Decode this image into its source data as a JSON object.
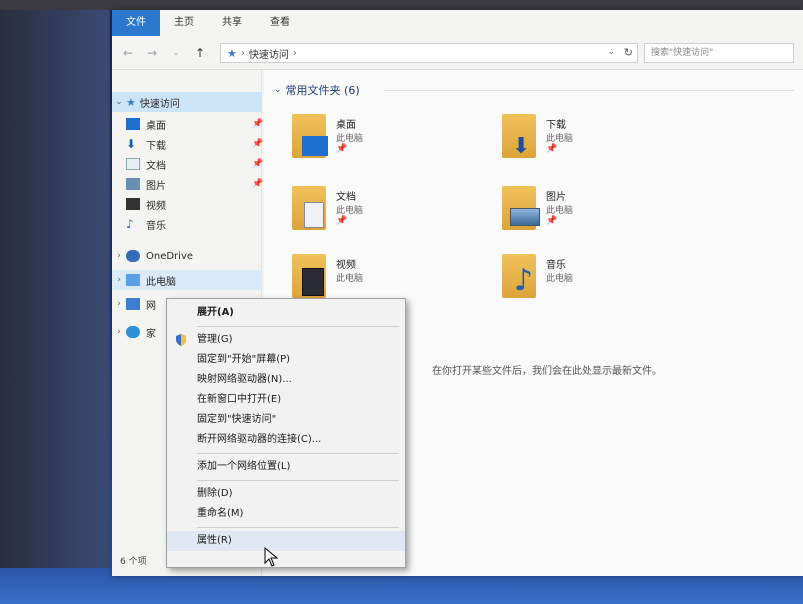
{
  "ribbon": {
    "tabs": [
      "文件",
      "主页",
      "共享",
      "查看"
    ]
  },
  "address": {
    "path": "快速访问",
    "search_placeholder": "搜索\"快速访问\""
  },
  "nav": {
    "quick_access": "快速访问",
    "items": [
      {
        "label": "桌面",
        "icon": "desktop-icon",
        "pinned": true
      },
      {
        "label": "下载",
        "icon": "download-icon",
        "pinned": true
      },
      {
        "label": "文档",
        "icon": "document-icon",
        "pinned": true
      },
      {
        "label": "图片",
        "icon": "pictures-icon",
        "pinned": true
      },
      {
        "label": "视频",
        "icon": "video-icon",
        "pinned": false
      },
      {
        "label": "音乐",
        "icon": "music-icon",
        "pinned": false
      }
    ],
    "onedrive": "OneDrive",
    "this_pc": "此电脑",
    "network_partial": "网",
    "homegroup_partial": "家"
  },
  "content": {
    "group_header": "常用文件夹 (6)",
    "tiles": [
      {
        "name": "桌面",
        "sub": "此电脑",
        "pinned": true
      },
      {
        "name": "下载",
        "sub": "此电脑",
        "pinned": true
      },
      {
        "name": "文档",
        "sub": "此电脑",
        "pinned": true
      },
      {
        "name": "图片",
        "sub": "此电脑",
        "pinned": true
      },
      {
        "name": "视频",
        "sub": "此电脑",
        "pinned": false
      },
      {
        "name": "音乐",
        "sub": "此电脑",
        "pinned": false
      }
    ],
    "empty_message": "在你打开某些文件后，我们会在此处显示最新文件。"
  },
  "status_bar": "6 个项",
  "context_menu": {
    "items": [
      {
        "label": "展开(A)",
        "bold": true
      },
      {
        "sep": true
      },
      {
        "label": "管理(G)",
        "shield": true
      },
      {
        "label": "固定到\"开始\"屏幕(P)"
      },
      {
        "label": "映射网络驱动器(N)..."
      },
      {
        "label": "在新窗口中打开(E)"
      },
      {
        "label": "固定到\"快速访问\""
      },
      {
        "label": "断开网络驱动器的连接(C)..."
      },
      {
        "sep": true
      },
      {
        "label": "添加一个网络位置(L)"
      },
      {
        "sep": true
      },
      {
        "label": "删除(D)"
      },
      {
        "label": "重命名(M)"
      },
      {
        "sep": true
      },
      {
        "label": "属性(R)",
        "highlight": true
      }
    ]
  },
  "colors": {
    "ribbon_blue": "#1b64b6",
    "selection": "#cce4f7",
    "folder": "#e4b24a"
  }
}
